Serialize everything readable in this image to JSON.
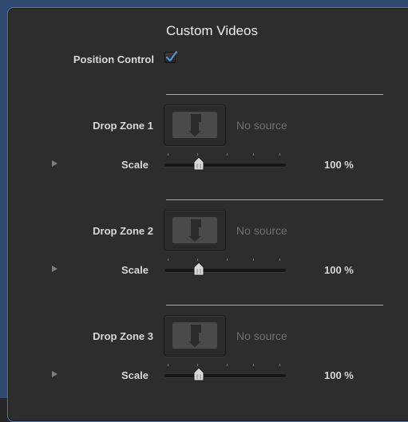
{
  "panel": {
    "title": "Custom Videos",
    "position_control": {
      "label": "Position Control",
      "checked": true
    }
  },
  "drop_zones": [
    {
      "label": "Drop Zone 1",
      "source_text": "No source",
      "scale_label": "Scale",
      "scale_value": "100 %",
      "scale_fraction": 0.28
    },
    {
      "label": "Drop Zone 2",
      "source_text": "No source",
      "scale_label": "Scale",
      "scale_value": "100 %",
      "scale_fraction": 0.28
    },
    {
      "label": "Drop Zone 3",
      "source_text": "No source",
      "scale_label": "Scale",
      "scale_value": "100 %",
      "scale_fraction": 0.28
    }
  ],
  "colors": {
    "accent": "#4f79ad",
    "checkmark": "#5b8ed6"
  }
}
